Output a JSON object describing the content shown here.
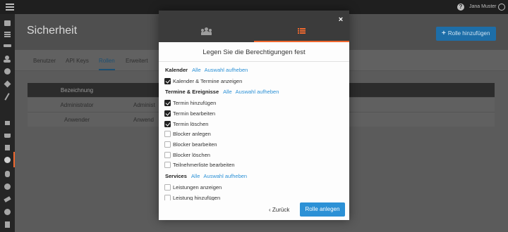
{
  "topbar": {
    "user_name": "Jana Muster",
    "help_label": "?"
  },
  "page": {
    "title": "Sicherheit",
    "add_role_button": "Rolle hinzufügen",
    "add_role_icon": "+"
  },
  "tabs": [
    "Benutzer",
    "API Keys",
    "Rollen",
    "Erweitert"
  ],
  "active_tab": "Rollen",
  "table": {
    "headers": [
      "Bezeichnung"
    ],
    "rows": [
      {
        "name": "Administrator",
        "desc": "Administ"
      },
      {
        "name": "Anwender",
        "desc": "Anwend"
      }
    ]
  },
  "sidebar_icons": [
    "calendar-icon",
    "list-icon",
    "graduation-icon",
    "users-icon",
    "chart-pie-icon",
    "star-icon",
    "percent-icon",
    "home-icon",
    "shopping-basket-icon",
    "box-icon",
    "lock-icon",
    "database-icon",
    "globe-icon",
    "send-icon",
    "gear-icon",
    "document-icon"
  ],
  "modal": {
    "close": "×",
    "tab_people_icon": "users-icon",
    "tab_list_icon": "list-icon",
    "title": "Legen Sie die Berechtigungen fest",
    "select_all": "Alle",
    "deselect": "Auswahl aufheben",
    "sections": [
      {
        "name": "Kalender",
        "items": [
          {
            "label": "Kalender & Termine anzeigen",
            "checked": true
          }
        ]
      },
      {
        "name": "Termine & Ereignisse",
        "items": [
          {
            "label": "Termin hinzufügen",
            "checked": true
          },
          {
            "label": "Termin bearbeiten",
            "checked": true
          },
          {
            "label": "Termin löschen",
            "checked": true
          },
          {
            "label": "Blocker anlegen",
            "checked": false
          },
          {
            "label": "Blocker bearbeiten",
            "checked": false
          },
          {
            "label": "Blocker löschen",
            "checked": false
          },
          {
            "label": "Teilnehmerliste bearbeiten",
            "checked": false
          }
        ]
      },
      {
        "name": "Services",
        "items": [
          {
            "label": "Leistungen anzeigen",
            "checked": false
          },
          {
            "label": "Leistung hinzufügen",
            "checked": false
          }
        ]
      }
    ],
    "back_label": "Zurück",
    "back_icon": "‹",
    "primary_label": "Rolle anlegen"
  },
  "colors": {
    "accent": "#f0682e",
    "primary": "#2c91d6",
    "link": "#2c91d6"
  }
}
